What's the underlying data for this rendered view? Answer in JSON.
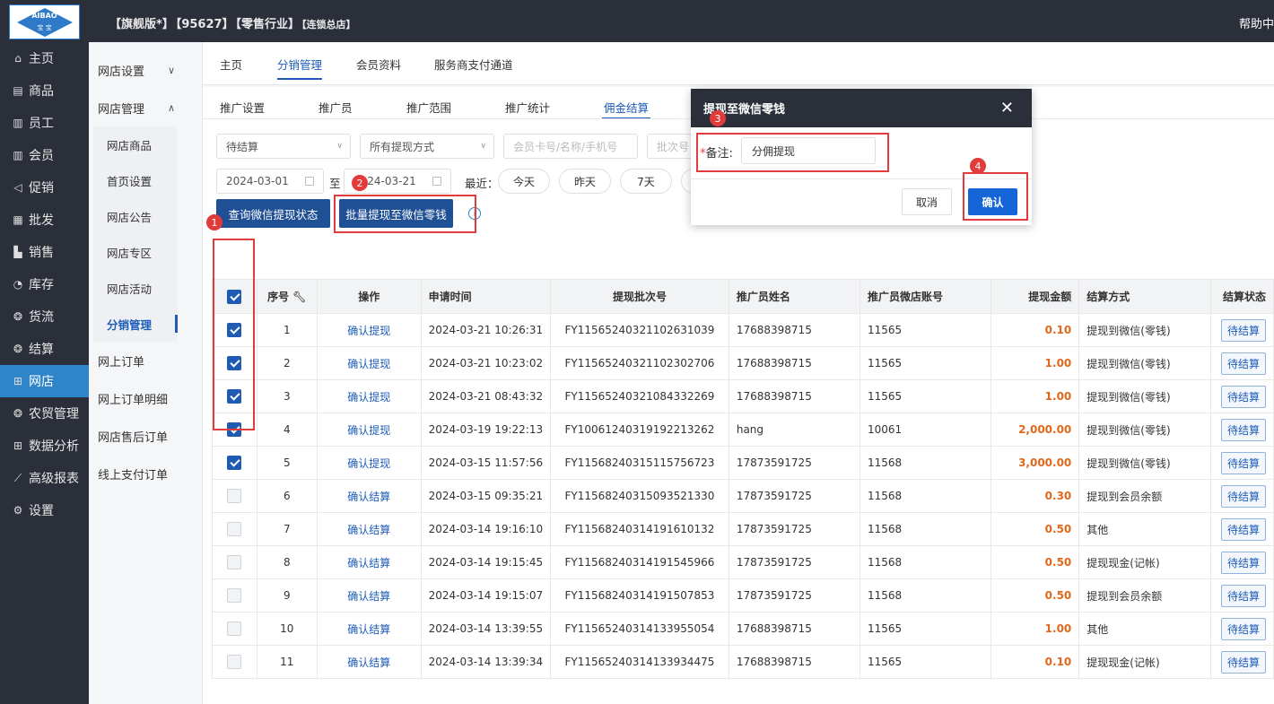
{
  "topbar": {
    "logo_text": "AIBAO",
    "logo_sub": "宝 宝",
    "edition": "【旗舰版*】",
    "store_id": "【95627】",
    "industry": "【零售行业】",
    "store_name": "【连锁总店】",
    "help": "帮助中"
  },
  "leftnav": [
    {
      "label": "主页",
      "icon": "home-icon",
      "glyph": "⌂"
    },
    {
      "label": "商品",
      "icon": "goods-icon",
      "glyph": "▤"
    },
    {
      "label": "员工",
      "icon": "staff-icon",
      "glyph": "▥"
    },
    {
      "label": "会员",
      "icon": "member-icon",
      "glyph": "▥"
    },
    {
      "label": "促销",
      "icon": "promo-icon",
      "glyph": "◁"
    },
    {
      "label": "批发",
      "icon": "wholesale-icon",
      "glyph": "▦"
    },
    {
      "label": "销售",
      "icon": "sales-icon",
      "glyph": "▙"
    },
    {
      "label": "库存",
      "icon": "stock-icon",
      "glyph": "◔"
    },
    {
      "label": "货流",
      "icon": "flow-icon",
      "glyph": "❂"
    },
    {
      "label": "结算",
      "icon": "settle-icon",
      "glyph": "❂"
    },
    {
      "label": "网店",
      "icon": "shop-icon",
      "glyph": "⊞"
    },
    {
      "label": "农贸管理",
      "icon": "farm-icon",
      "glyph": "❂"
    },
    {
      "label": "数据分析",
      "icon": "data-icon",
      "glyph": "⊞"
    },
    {
      "label": "高级报表",
      "icon": "report-icon",
      "glyph": "⟋"
    },
    {
      "label": "设置",
      "icon": "settings-icon",
      "glyph": "⚙"
    }
  ],
  "subnav": {
    "shop_settings": "网店设置",
    "shop_manage": "网店管理",
    "children": [
      "网店商品",
      "首页设置",
      "网店公告",
      "网店专区",
      "网店活动",
      "分销管理"
    ],
    "online_orders": "网上订单",
    "online_order_detail": "网上订单明细",
    "after_sales": "网店售后订单",
    "online_pay": "线上支付订单"
  },
  "toptabs": [
    "主页",
    "分销管理",
    "会员资料",
    "服务商支付通道"
  ],
  "subtabs": [
    "推广设置",
    "推广员",
    "推广范围",
    "推广统计",
    "佣金结算"
  ],
  "filters": {
    "status": "待结算",
    "method": "所有提现方式",
    "member_ph": "会员卡号/名称/手机号",
    "batch_ph": "批次号",
    "date_from": "2024-03-01",
    "to": "至",
    "date_to": "2024-03-21",
    "recent": "最近：",
    "quick": [
      "今天",
      "昨天",
      "7天"
    ]
  },
  "buttons": {
    "query": "查询微信提现状态",
    "batch": "批量提现至微信零钱"
  },
  "table": {
    "headers": [
      "序号",
      "操作",
      "申请时间",
      "提现批次号",
      "推广员姓名",
      "推广员微店账号",
      "提现金额",
      "结算方式",
      "结算状态"
    ],
    "rows": [
      {
        "checked": true,
        "no": "1",
        "op": "确认提现",
        "time": "2024-03-21 10:26:31",
        "batch": "FY11565240321102631039",
        "name": "17688398715",
        "acct": "11565",
        "amt": "0.10",
        "method": "提现到微信(零钱)",
        "status": "待结算"
      },
      {
        "checked": true,
        "no": "2",
        "op": "确认提现",
        "time": "2024-03-21 10:23:02",
        "batch": "FY11565240321102302706",
        "name": "17688398715",
        "acct": "11565",
        "amt": "1.00",
        "method": "提现到微信(零钱)",
        "status": "待结算"
      },
      {
        "checked": true,
        "no": "3",
        "op": "确认提现",
        "time": "2024-03-21 08:43:32",
        "batch": "FY11565240321084332269",
        "name": "17688398715",
        "acct": "11565",
        "amt": "1.00",
        "method": "提现到微信(零钱)",
        "status": "待结算"
      },
      {
        "checked": true,
        "no": "4",
        "op": "确认提现",
        "time": "2024-03-19 19:22:13",
        "batch": "FY10061240319192213262",
        "name": "hang",
        "acct": "10061",
        "amt": "2,000.00",
        "method": "提现到微信(零钱)",
        "status": "待结算"
      },
      {
        "checked": true,
        "no": "5",
        "op": "确认提现",
        "time": "2024-03-15 11:57:56",
        "batch": "FY11568240315115756723",
        "name": "17873591725",
        "acct": "11568",
        "amt": "3,000.00",
        "method": "提现到微信(零钱)",
        "status": "待结算"
      },
      {
        "checked": false,
        "no": "6",
        "op": "确认结算",
        "time": "2024-03-15 09:35:21",
        "batch": "FY11568240315093521330",
        "name": "17873591725",
        "acct": "11568",
        "amt": "0.30",
        "method": "提现到会员余额",
        "status": "待结算"
      },
      {
        "checked": false,
        "no": "7",
        "op": "确认结算",
        "time": "2024-03-14 19:16:10",
        "batch": "FY11568240314191610132",
        "name": "17873591725",
        "acct": "11568",
        "amt": "0.50",
        "method": "其他",
        "status": "待结算"
      },
      {
        "checked": false,
        "no": "8",
        "op": "确认结算",
        "time": "2024-03-14 19:15:45",
        "batch": "FY11568240314191545966",
        "name": "17873591725",
        "acct": "11568",
        "amt": "0.50",
        "method": "提现现金(记帐)",
        "status": "待结算"
      },
      {
        "checked": false,
        "no": "9",
        "op": "确认结算",
        "time": "2024-03-14 19:15:07",
        "batch": "FY11568240314191507853",
        "name": "17873591725",
        "acct": "11568",
        "amt": "0.50",
        "method": "提现到会员余额",
        "status": "待结算"
      },
      {
        "checked": false,
        "no": "10",
        "op": "确认结算",
        "time": "2024-03-14 13:39:55",
        "batch": "FY11565240314133955054",
        "name": "17688398715",
        "acct": "11565",
        "amt": "1.00",
        "method": "其他",
        "status": "待结算"
      },
      {
        "checked": false,
        "no": "11",
        "op": "确认结算",
        "time": "2024-03-14 13:39:34",
        "batch": "FY11565240314133934475",
        "name": "17688398715",
        "acct": "11565",
        "amt": "0.10",
        "method": "提现现金(记帐)",
        "status": "待结算"
      }
    ]
  },
  "modal": {
    "title": "提现至微信零钱",
    "close": "✕",
    "remark_star": "*",
    "remark_label": "备注:",
    "remark_value": "分佣提现",
    "cancel": "取消",
    "ok": "确认"
  },
  "badges": [
    "1",
    "2",
    "3",
    "4"
  ],
  "colors": {
    "nav_bg": "#2b2f3a",
    "accent": "#1f4f95",
    "active_nav": "#2e86c9",
    "amount": "#e0681b",
    "marker": "#e23b3b"
  }
}
